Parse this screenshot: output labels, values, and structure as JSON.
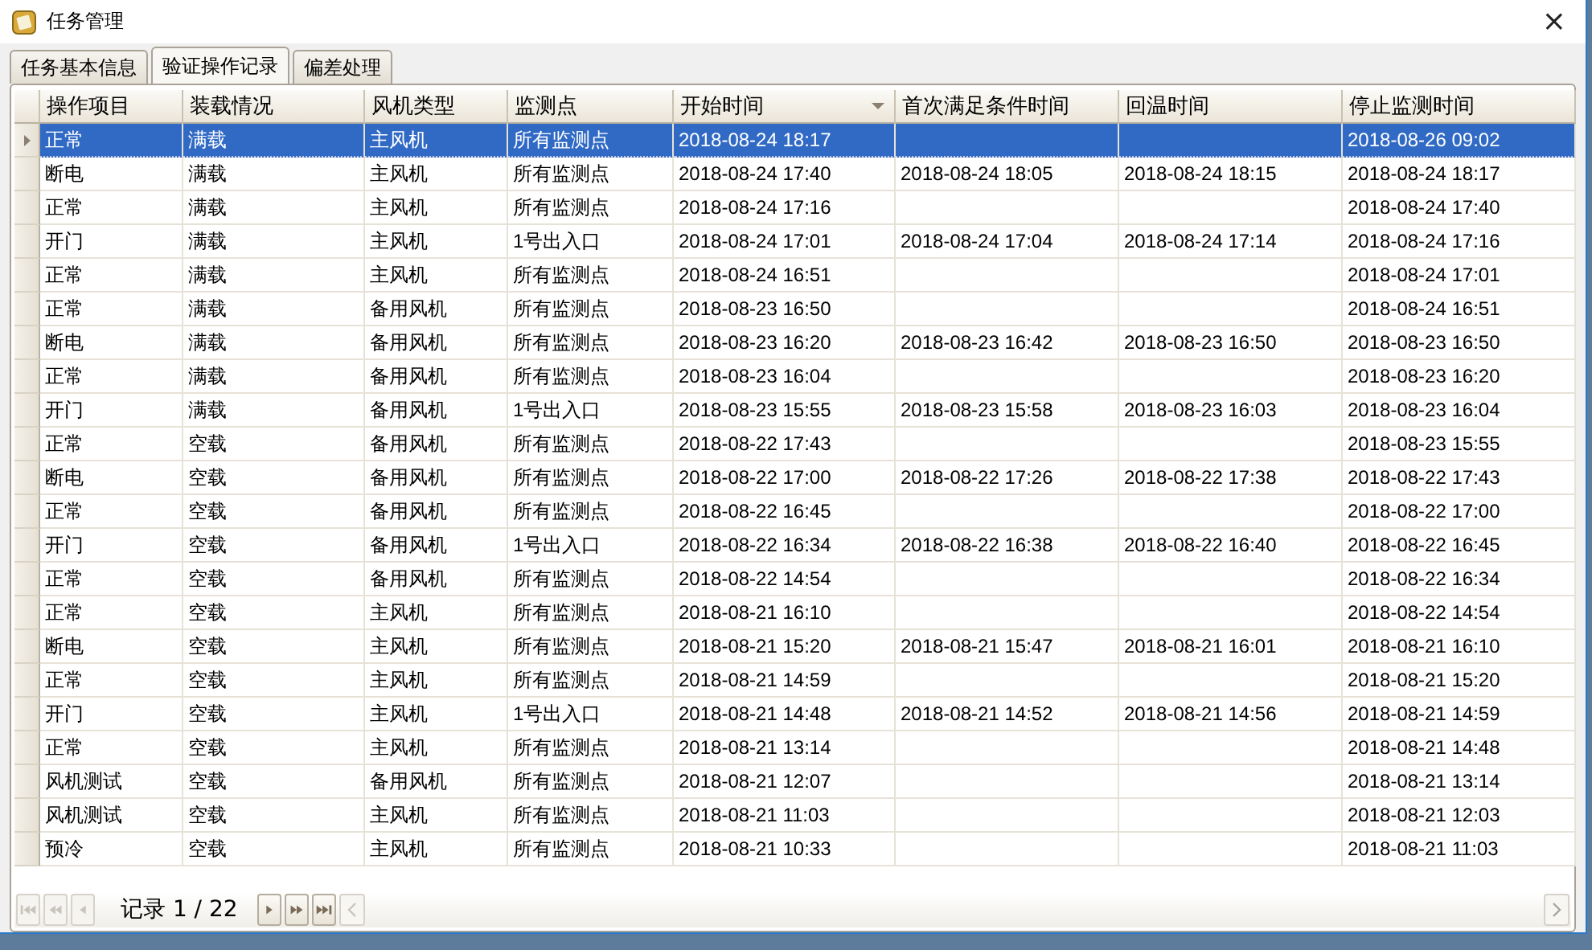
{
  "window": {
    "title": "任务管理",
    "close": "×"
  },
  "tabs": [
    {
      "label": "任务基本信息",
      "selected": false
    },
    {
      "label": "验证操作记录",
      "selected": true
    },
    {
      "label": "偏差处理",
      "selected": false
    }
  ],
  "table": {
    "columns": [
      {
        "label": "操作项目",
        "sorted": false
      },
      {
        "label": "装载情况",
        "sorted": false
      },
      {
        "label": "风机类型",
        "sorted": false
      },
      {
        "label": "监测点",
        "sorted": false
      },
      {
        "label": "开始时间",
        "sorted": true
      },
      {
        "label": "首次满足条件时间",
        "sorted": false
      },
      {
        "label": "回温时间",
        "sorted": false
      },
      {
        "label": "停止监测时间",
        "sorted": false
      }
    ],
    "rows": [
      {
        "selected": true,
        "cells": [
          "正常",
          "满载",
          "主风机",
          "所有监测点",
          "2018-08-24 18:17",
          null,
          null,
          "2018-08-26 09:02"
        ]
      },
      {
        "selected": false,
        "cells": [
          "断电",
          "满载",
          "主风机",
          "所有监测点",
          "2018-08-24 17:40",
          "2018-08-24 18:05",
          "2018-08-24 18:15",
          "2018-08-24 18:17"
        ]
      },
      {
        "selected": false,
        "cells": [
          "正常",
          "满载",
          "主风机",
          "所有监测点",
          "2018-08-24 17:16",
          null,
          null,
          "2018-08-24 17:40"
        ]
      },
      {
        "selected": false,
        "cells": [
          "开门",
          "满载",
          "主风机",
          "1号出入口",
          "2018-08-24 17:01",
          "2018-08-24 17:04",
          "2018-08-24 17:14",
          "2018-08-24 17:16"
        ]
      },
      {
        "selected": false,
        "cells": [
          "正常",
          "满载",
          "主风机",
          "所有监测点",
          "2018-08-24 16:51",
          null,
          null,
          "2018-08-24 17:01"
        ]
      },
      {
        "selected": false,
        "cells": [
          "正常",
          "满载",
          "备用风机",
          "所有监测点",
          "2018-08-23 16:50",
          null,
          null,
          "2018-08-24 16:51"
        ]
      },
      {
        "selected": false,
        "cells": [
          "断电",
          "满载",
          "备用风机",
          "所有监测点",
          "2018-08-23 16:20",
          "2018-08-23 16:42",
          "2018-08-23 16:50",
          "2018-08-23 16:50"
        ]
      },
      {
        "selected": false,
        "cells": [
          "正常",
          "满载",
          "备用风机",
          "所有监测点",
          "2018-08-23 16:04",
          null,
          null,
          "2018-08-23 16:20"
        ]
      },
      {
        "selected": false,
        "cells": [
          "开门",
          "满载",
          "备用风机",
          "1号出入口",
          "2018-08-23 15:55",
          "2018-08-23 15:58",
          "2018-08-23 16:03",
          "2018-08-23 16:04"
        ]
      },
      {
        "selected": false,
        "cells": [
          "正常",
          "空载",
          "备用风机",
          "所有监测点",
          "2018-08-22 17:43",
          null,
          null,
          "2018-08-23 15:55"
        ]
      },
      {
        "selected": false,
        "cells": [
          "断电",
          "空载",
          "备用风机",
          "所有监测点",
          "2018-08-22 17:00",
          "2018-08-22 17:26",
          "2018-08-22 17:38",
          "2018-08-22 17:43"
        ]
      },
      {
        "selected": false,
        "cells": [
          "正常",
          "空载",
          "备用风机",
          "所有监测点",
          "2018-08-22 16:45",
          null,
          null,
          "2018-08-22 17:00"
        ]
      },
      {
        "selected": false,
        "cells": [
          "开门",
          "空载",
          "备用风机",
          "1号出入口",
          "2018-08-22 16:34",
          "2018-08-22 16:38",
          "2018-08-22 16:40",
          "2018-08-22 16:45"
        ]
      },
      {
        "selected": false,
        "cells": [
          "正常",
          "空载",
          "备用风机",
          "所有监测点",
          "2018-08-22 14:54",
          null,
          null,
          "2018-08-22 16:34"
        ]
      },
      {
        "selected": false,
        "cells": [
          "正常",
          "空载",
          "主风机",
          "所有监测点",
          "2018-08-21 16:10",
          null,
          null,
          "2018-08-22 14:54"
        ]
      },
      {
        "selected": false,
        "cells": [
          "断电",
          "空载",
          "主风机",
          "所有监测点",
          "2018-08-21 15:20",
          "2018-08-21 15:47",
          "2018-08-21 16:01",
          "2018-08-21 16:10"
        ]
      },
      {
        "selected": false,
        "cells": [
          "正常",
          "空载",
          "主风机",
          "所有监测点",
          "2018-08-21 14:59",
          null,
          null,
          "2018-08-21 15:20"
        ]
      },
      {
        "selected": false,
        "cells": [
          "开门",
          "空载",
          "主风机",
          "1号出入口",
          "2018-08-21 14:48",
          "2018-08-21 14:52",
          "2018-08-21 14:56",
          "2018-08-21 14:59"
        ]
      },
      {
        "selected": false,
        "cells": [
          "正常",
          "空载",
          "主风机",
          "所有监测点",
          "2018-08-21 13:14",
          null,
          null,
          "2018-08-21 14:48"
        ]
      },
      {
        "selected": false,
        "cells": [
          "风机测试",
          "空载",
          "备用风机",
          "所有监测点",
          "2018-08-21 12:07",
          null,
          null,
          "2018-08-21 13:14"
        ]
      },
      {
        "selected": false,
        "cells": [
          "风机测试",
          "空载",
          "主风机",
          "所有监测点",
          "2018-08-21 11:03",
          null,
          null,
          "2018-08-21 12:03"
        ]
      },
      {
        "selected": false,
        "cells": [
          "预冷",
          "空载",
          "主风机",
          "所有监测点",
          "2018-08-21 10:33",
          null,
          null,
          "2018-08-21 11:03"
        ]
      }
    ]
  },
  "navigator": {
    "buttons": [
      {
        "kind": "first",
        "disabled": true
      },
      {
        "kind": "prev-page",
        "disabled": true
      },
      {
        "kind": "prev",
        "disabled": true
      },
      {
        "kind": "record"
      },
      {
        "kind": "next",
        "disabled": false
      },
      {
        "kind": "next-page",
        "disabled": false
      },
      {
        "kind": "last",
        "disabled": false
      }
    ],
    "record_text": "记录 1 / 22"
  }
}
